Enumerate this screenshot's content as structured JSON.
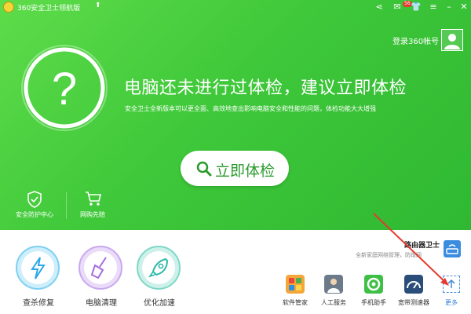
{
  "titlebar": {
    "title": "360安全卫士领航版",
    "arrow_icon": "up-arrow-icon",
    "badge": "56",
    "buttons": [
      "share-icon",
      "mail-icon",
      "skin-icon",
      "menu-icon",
      "minimize-icon",
      "close-icon"
    ]
  },
  "account": {
    "login_label": "登录360帐号"
  },
  "status": {
    "ring_symbol": "?",
    "headline": "电脑还未进行过体检，建议立即体检",
    "subline": "安全卫士全新版本可以更全面、高效地查出影响电脑安全和性能的问题，体检功能大大增强"
  },
  "check_button": {
    "label": "立即体检"
  },
  "left_links": [
    {
      "label": "安全防护中心",
      "icon": "shield-icon"
    },
    {
      "label": "网购先赔",
      "icon": "cart-icon"
    }
  ],
  "tools": [
    {
      "label": "查杀修复",
      "icon": "lightning-icon",
      "color": "#2aa8e8"
    },
    {
      "label": "电脑清理",
      "icon": "broom-icon",
      "color": "#a66bdc"
    },
    {
      "label": "优化加速",
      "icon": "rocket-icon",
      "color": "#2cb9a8"
    }
  ],
  "router": {
    "title": "路由器卫士",
    "subtitle": "全新家庭网络管理，防蹭网"
  },
  "apps": [
    {
      "label": "软件管家",
      "icon": "software-manager-icon"
    },
    {
      "label": "人工服务",
      "icon": "human-service-icon"
    },
    {
      "label": "手机助手",
      "icon": "phone-assistant-icon"
    },
    {
      "label": "宽带测速器",
      "icon": "speedometer-icon"
    }
  ],
  "more": {
    "label": "更多",
    "icon": "upload-arrow-icon"
  },
  "colors": {
    "green_top": "#5edc4a",
    "green_bottom": "#2fb832",
    "annotation_arrow": "#e53a2e"
  }
}
